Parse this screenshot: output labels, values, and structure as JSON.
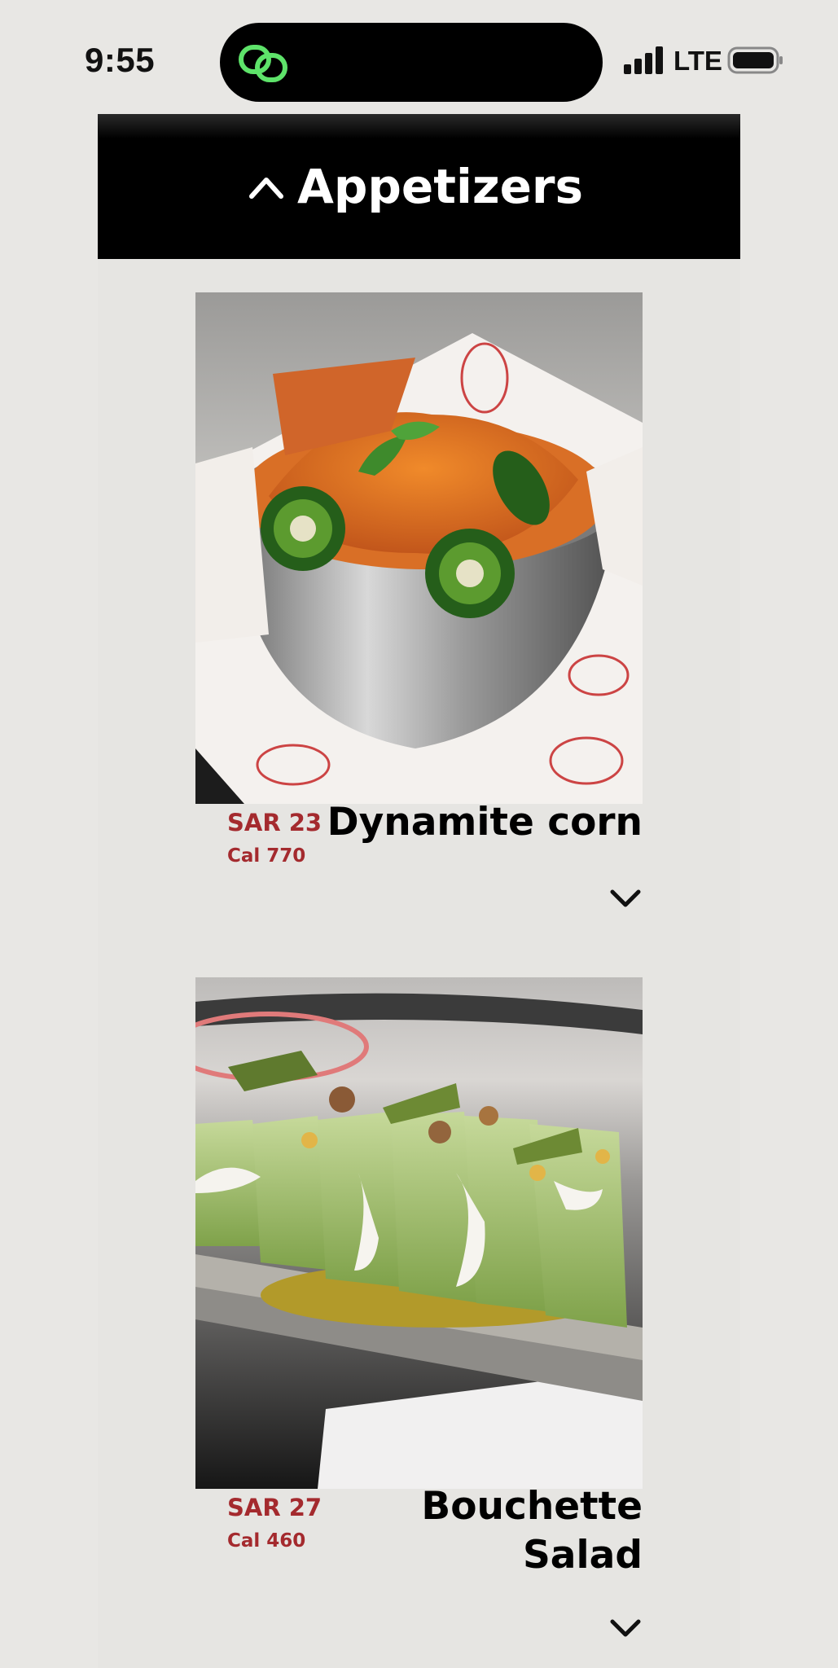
{
  "status_bar": {
    "time": "9:55",
    "network": "LTE",
    "icons": [
      "link-app-icon",
      "signal-icon",
      "battery-icon"
    ]
  },
  "menu": {
    "section_title": "Appetizers",
    "section_icon": "chevron-up-icon",
    "items": [
      {
        "name": "Dynamite corn",
        "price": "SAR 23",
        "calories": "Cal 770",
        "expand_icon": "chevron-down-icon"
      },
      {
        "name_lines": [
          "Bouchette",
          "Salad"
        ],
        "price": "SAR 27",
        "calories": "Cal 460",
        "expand_icon": "chevron-down-icon"
      }
    ]
  },
  "colors": {
    "background": "#e8e7e4",
    "header": "#000000",
    "price": "#a42a2e",
    "island_accent": "#5ee36a"
  }
}
